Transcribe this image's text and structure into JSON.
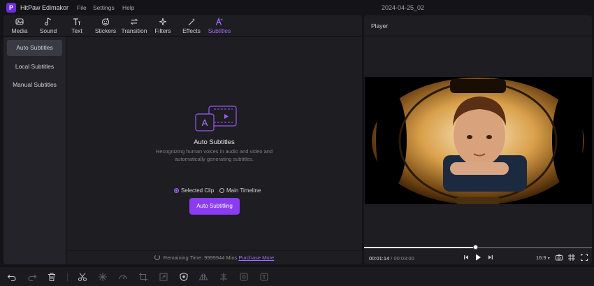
{
  "app": {
    "name": "HitPaw Edimakor",
    "logo_glyph": "P",
    "document_title": "2024-04-25_02",
    "menu": [
      "File",
      "Settings",
      "Help"
    ]
  },
  "toolbar": {
    "tools": [
      {
        "label": "Media",
        "icon": "media-icon"
      },
      {
        "label": "Sound",
        "icon": "music-note-icon"
      },
      {
        "label": "Text",
        "icon": "text-icon"
      },
      {
        "label": "Stickers",
        "icon": "sticker-icon"
      },
      {
        "label": "Transition",
        "icon": "transition-arrows-icon"
      },
      {
        "label": "Filters",
        "icon": "sparkle-icon"
      },
      {
        "label": "Effects",
        "icon": "magic-wand-icon"
      },
      {
        "label": "Subtitles",
        "icon": "subtitle-icon",
        "active": true
      }
    ]
  },
  "sidenav": {
    "items": [
      {
        "label": "Auto Subtitles",
        "active": true
      },
      {
        "label": "Local Subtitles"
      },
      {
        "label": "Manual Subtitles"
      }
    ]
  },
  "auto_subtitles": {
    "icon_letter": "A",
    "title": "Auto Subtitles",
    "description": "Recognizing human voices in audio and video and automatically generating subtitles.",
    "options": [
      {
        "label": "Selected Clip",
        "selected": true
      },
      {
        "label": "Main Timeline",
        "selected": false
      }
    ],
    "button_label": "Auto Subtitling",
    "footer_text": "Remaining Time: 9999944 Mins",
    "footer_link": "Purchase More"
  },
  "player": {
    "title": "Player",
    "current_time": "00:01:14",
    "time_separator": "/",
    "total_time": "00:03:00",
    "progress": 0.488,
    "aspect_ratio": "16:9",
    "icons": [
      "prev-frame-icon",
      "play-icon",
      "next-frame-icon",
      "camera-snapshot-icon",
      "crop-grid-icon",
      "fullscreen-icon"
    ]
  },
  "bottom_toolbar": {
    "icons": [
      "undo-icon",
      "redo-icon",
      "delete-icon",
      "split-scissors-icon",
      "freeze-icon",
      "speed-icon",
      "crop-icon",
      "transform-icon",
      "mask-icon",
      "mirror-icon",
      "align-icon",
      "tag-icon",
      "text-to-speech-icon"
    ]
  },
  "colors": {
    "accent": "#8a3cf2",
    "accent_text": "#a46bff",
    "background": "#141418",
    "panel": "#1d1d22"
  }
}
